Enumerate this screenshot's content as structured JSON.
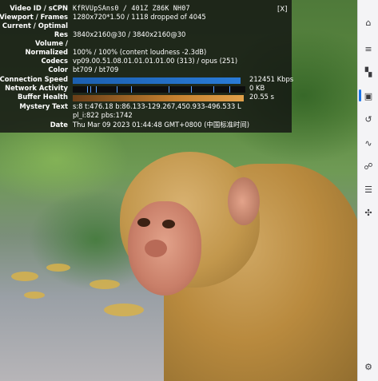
{
  "stats": {
    "close_label": "[X]",
    "rows": [
      {
        "label": "Video ID / sCPN",
        "value": "KfRVUpSAns0 / 401Z Z86K NH07",
        "mono": true
      },
      {
        "label": "Viewport / Frames",
        "value": "1280x720*1.50 / 1118 dropped of 4045"
      },
      {
        "label": "Current / Optimal",
        "value": ""
      },
      {
        "label": "Res",
        "value": "3840x2160@30 / 3840x2160@30"
      },
      {
        "label": "Volume /",
        "value": ""
      },
      {
        "label": "Normalized",
        "value": "100% / 100% (content loudness -2.3dB)"
      },
      {
        "label": "Codecs",
        "value": "vp09.00.51.08.01.01.01.01.00 (313) / opus (251)"
      },
      {
        "label": "Color",
        "value": "bt709 / bt709"
      },
      {
        "label": "Connection Speed",
        "value": "212451 Kbps"
      },
      {
        "label": "Network Activity",
        "value": "0 KB"
      },
      {
        "label": "Buffer Health",
        "value": "20.55 s"
      },
      {
        "label": "Mystery Text",
        "value": "s:8 t:476.18 b:86.133-129.267,450.933-496.533 L"
      },
      {
        "label": "",
        "value": "pl_i:822 pbs:1742"
      },
      {
        "label": "Date",
        "value": "Thu Mar 09 2023 01:44:48 GMT+0800 (中国标准时间)"
      }
    ],
    "connection_speed_fraction": 0.97,
    "buffer_health_fraction": 0.99
  },
  "sidebar": {
    "icons": [
      {
        "name": "sidebar-top-icon",
        "glyph": "⌂"
      },
      {
        "name": "menu-icon",
        "glyph": "≡"
      },
      {
        "name": "layout-icon",
        "glyph": "▚"
      },
      {
        "name": "image-icon",
        "glyph": "▣"
      },
      {
        "name": "history-icon",
        "glyph": "↺"
      },
      {
        "name": "signature-icon",
        "glyph": "∿"
      },
      {
        "name": "people-icon",
        "glyph": "☍"
      },
      {
        "name": "list-icon",
        "glyph": "☰"
      },
      {
        "name": "puzzle-icon",
        "glyph": "✣"
      },
      {
        "name": "settings-icon",
        "glyph": "⚙"
      }
    ]
  },
  "colors": {
    "overlay": "#121212",
    "connection_bar": "#2a7bd6",
    "buffer_bar": "#d38f3d",
    "sidebar_accent": "#1a73e8"
  }
}
